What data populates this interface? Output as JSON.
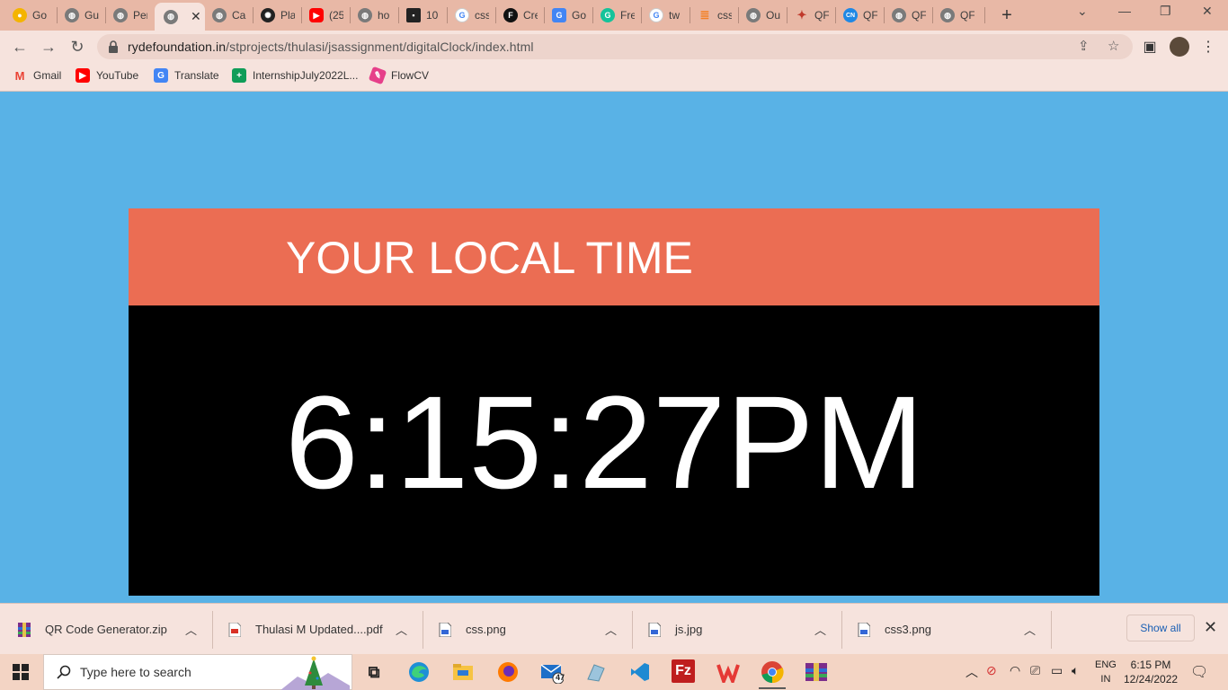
{
  "browser": {
    "tabs": [
      {
        "title": "Go",
        "icon": "bulb-icon",
        "color": "#f4b400"
      },
      {
        "title": "Gu",
        "icon": "globe-icon",
        "color": "#666666"
      },
      {
        "title": "Per",
        "icon": "globe-icon",
        "color": "#666666"
      },
      {
        "title": "",
        "icon": "globe-icon",
        "color": "#666666",
        "active": true
      },
      {
        "title": "Ca",
        "icon": "globe-icon",
        "color": "#666666"
      },
      {
        "title": "Pla",
        "icon": "openai-icon",
        "color": "#222222"
      },
      {
        "title": "(25",
        "icon": "youtube-icon",
        "color": "#ff0000"
      },
      {
        "title": "ho",
        "icon": "globe-icon",
        "color": "#666666"
      },
      {
        "title": "10",
        "icon": "app-icon",
        "color": "#222222"
      },
      {
        "title": "css",
        "icon": "google-icon",
        "color": "#4285f4"
      },
      {
        "title": "Cre",
        "icon": "f-icon",
        "color": "#111111"
      },
      {
        "title": "Go",
        "icon": "translate-icon",
        "color": "#4285f4"
      },
      {
        "title": "Fre",
        "icon": "grammarly-icon",
        "color": "#15c39a"
      },
      {
        "title": "tw",
        "icon": "google-icon",
        "color": "#4285f4"
      },
      {
        "title": "css",
        "icon": "stackoverflow-icon",
        "color": "#f48024"
      },
      {
        "title": "Ou",
        "icon": "globe-icon",
        "color": "#666666"
      },
      {
        "title": "QF",
        "icon": "runner-icon",
        "color": "#c0392b"
      },
      {
        "title": "QF",
        "icon": "cn-icon",
        "color": "#1e88e5"
      },
      {
        "title": "QF",
        "icon": "globe-icon",
        "color": "#666666"
      },
      {
        "title": "QF",
        "icon": "globe-icon",
        "color": "#666666"
      }
    ],
    "url_host": "rydefoundation.in",
    "url_path": "/stprojects/thulasi/jsassignment/digitalClock/index.html",
    "bookmarks": [
      {
        "label": "Gmail",
        "icon": "gmail-icon",
        "color": "#ea4335"
      },
      {
        "label": "YouTube",
        "icon": "youtube-icon",
        "color": "#ff0000"
      },
      {
        "label": "Translate",
        "icon": "translate-icon",
        "color": "#4285f4"
      },
      {
        "label": "InternshipJuly2022L...",
        "icon": "sheets-icon",
        "color": "#0f9d58"
      },
      {
        "label": "FlowCV",
        "icon": "flowcv-icon",
        "color": "#e6408a"
      }
    ]
  },
  "clock": {
    "heading": "YOUR LOCAL TIME",
    "time": "6:15:27PM",
    "header_color": "#eb6d53",
    "body_color": "#000000",
    "page_color": "#59b2e6"
  },
  "downloads": {
    "items": [
      {
        "name": "QR Code Generator.zip",
        "icon": "zip-icon"
      },
      {
        "name": "Thulasi M Updated....pdf",
        "icon": "pdf-icon"
      },
      {
        "name": "css.png",
        "icon": "image-file-icon"
      },
      {
        "name": "js.jpg",
        "icon": "image-file-icon"
      },
      {
        "name": "css3.png",
        "icon": "image-file-icon"
      }
    ],
    "show_all": "Show all"
  },
  "taskbar": {
    "search_placeholder": "Type here to search",
    "mail_badge": "47",
    "lang_top": "ENG",
    "lang_bottom": "IN",
    "time": "6:15 PM",
    "date": "12/24/2022"
  }
}
